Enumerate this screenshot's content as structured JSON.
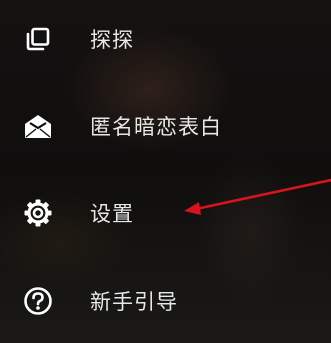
{
  "menu": {
    "items": [
      {
        "label": "探探",
        "icon": "gallery-stack-icon"
      },
      {
        "label": "匿名暗恋表白",
        "icon": "open-envelope-icon"
      },
      {
        "label": "设置",
        "icon": "gear-icon"
      },
      {
        "label": "新手引导",
        "icon": "help-circle-icon"
      }
    ]
  },
  "colors": {
    "text": "#e8e8e8",
    "icon": "#ffffff",
    "annotation_arrow": "#d9131e"
  }
}
